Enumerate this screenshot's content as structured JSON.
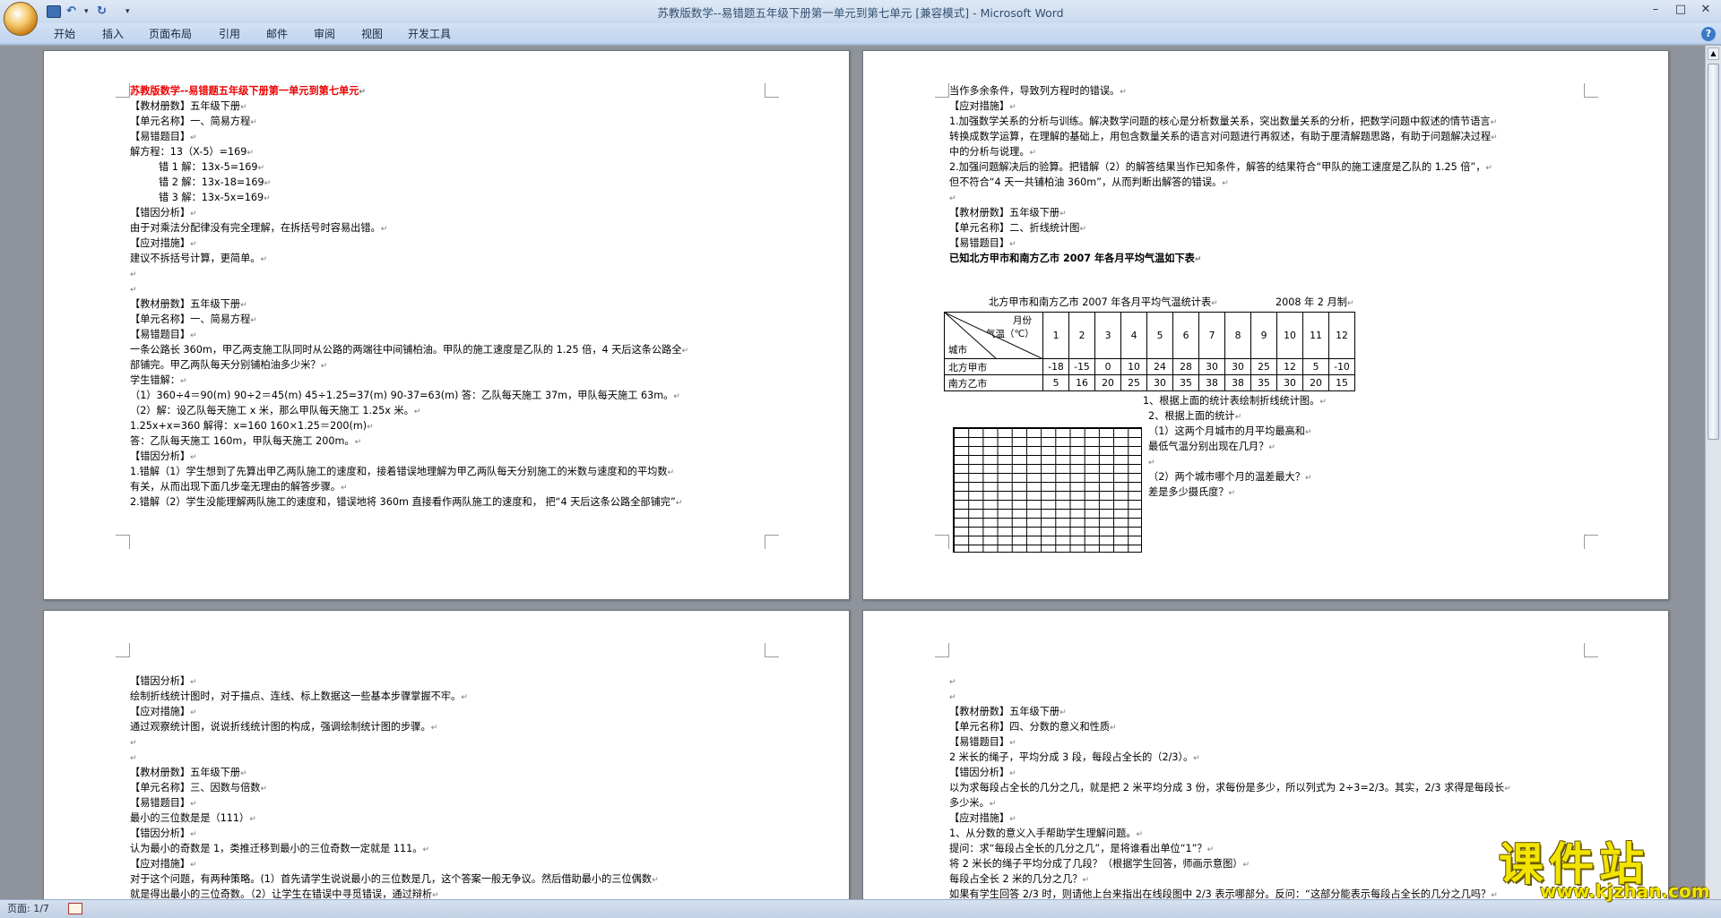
{
  "window": {
    "title": "苏教版数学--易错题五年级下册第一单元到第七单元 [兼容模式] - Microsoft Word"
  },
  "quick_access": {
    "save_icon": "save-icon",
    "undo_icon": "undo-icon",
    "redo_icon": "redo-icon"
  },
  "ribbon": {
    "tabs": [
      "开始",
      "插入",
      "页面布局",
      "引用",
      "邮件",
      "审阅",
      "视图",
      "开发工具"
    ]
  },
  "status": {
    "page": "页面: 1/7"
  },
  "watermark": {
    "text": "课件站",
    "url": "www.kjzhan.com"
  },
  "page1": {
    "lines": [
      "苏教版数学--易错题五年级下册第一单元到第七单元",
      "【教材册数】五年级下册",
      "【单元名称】一、简易方程",
      "【易错题目】",
      "解方程：13（X-5）=169",
      "错 1 解：13x-5=169",
      "错 2 解：13x-18=169",
      "错 3 解：13x-5x=169",
      "【错因分析】",
      "由于对乘法分配律没有完全理解，在拆括号时容易出错。",
      "【应对措施】",
      "建议不拆括号计算，更简单。",
      "",
      "",
      "【教材册数】五年级下册",
      "【单元名称】一、简易方程",
      "【易错题目】",
      "一条公路长 360m，甲乙两支施工队同时从公路的两端往中间铺柏油。甲队的施工速度是乙队的 1.25 倍，4 天后这条公路全",
      "部铺完。甲乙两队每天分别铺柏油多少米？",
      "学生错解：",
      "（1）360÷4＝90(m)    90÷2＝45(m)    45÷1.25=37(m)    90-37=63(m) 答：乙队每天施工 37m，甲队每天施工 63m。",
      "（2）解：设乙队每天施工 x 米，那么甲队每天施工 1.25x 米。",
      "1.25x+x=360 解得：x=160    160×1.25＝200(m)",
      "答：乙队每天施工 160m，甲队每天施工 200m。",
      "【错因分析】",
      "1.错解（1）学生想到了先算出甲乙两队施工的速度和，接着错误地理解为甲乙两队每天分别施工的米数与速度和的平均数",
      "有关，从而出现下面几步毫无理由的解答步骤。",
      "2.错解（2）学生没能理解两队施工的速度和，错误地将 360m 直接看作两队施工的速度和，  把“4 天后这条公路全部铺完”"
    ]
  },
  "page2": {
    "lines": [
      "当作多余条件，导致列方程时的错误。",
      "【应对措施】",
      "1.加强数学关系的分析与训练。解决数学问题的核心是分析数量关系，突出数量关系的分析，把数学问题中叙述的情节语言",
      "转换成数学运算，在理解的基础上，用包含数量关系的语言对问题进行再叙述，有助于厘清解题思路，有助于问题解决过程",
      "中的分析与说理。",
      "2.加强问题解决后的验算。把错解（2）的解答结果当作已知条件，解答的结果符合“甲队的施工速度是乙队的 1.25 倍”，",
      "但不符合“4 天一共铺柏油 360m”，从而判断出解答的错误。",
      "",
      "【教材册数】五年级下册",
      "【单元名称】二、折线统计图",
      "【易错题目】",
      "已知北方甲市和南方乙市 2007 年各月平均气温如下表"
    ],
    "table_caption": "北方甲市和南方乙市 2007 年各月平均气温统计表",
    "table_date": "2008 年 2 月制",
    "table_header_labels": {
      "month": "月份",
      "temp": "气温（℃）",
      "city": "城市"
    },
    "months": [
      "1",
      "2",
      "3",
      "4",
      "5",
      "6",
      "7",
      "8",
      "9",
      "10",
      "11",
      "12"
    ],
    "rows": [
      {
        "city": "北方甲市",
        "values": [
          "-18",
          "-15",
          "0",
          "10",
          "24",
          "28",
          "30",
          "30",
          "25",
          "12",
          "5",
          "-10"
        ]
      },
      {
        "city": "南方乙市",
        "values": [
          "5",
          "16",
          "20",
          "25",
          "30",
          "35",
          "38",
          "38",
          "35",
          "30",
          "20",
          "15"
        ]
      }
    ],
    "questions": [
      "1、根据上面的统计表绘制折线统计图。",
      "2、根据上面的统计",
      "（1）这两个月城市的月平均最高和",
      "最低气温分别出现在几月？",
      "",
      "（2）两个城市哪个月的温差最大？",
      "差是多少摄氏度？"
    ]
  },
  "page3": {
    "lines": [
      "【错因分析】",
      "绘制折线统计图时，对于描点、连线、标上数据这一些基本步骤掌握不牢。",
      "【应对措施】",
      "通过观察统计图，说说折线统计图的构成，强调绘制统计图的步骤。",
      "",
      "",
      "【教材册数】五年级下册",
      "【单元名称】三、因数与倍数",
      "【易错题目】",
      "最小的三位数是是（111）",
      "【错因分析】",
      "认为最小的奇数是 1，类推迁移到最小的三位奇数一定就是 111。",
      "【应对措施】",
      "对于这个问题，有两种策略。(1）首先请学生说说最小的三位数是几，这个答案一般无争议。然后借助最小的三位偶数",
      "就是得出最小的三位奇数。（2）让学生在错误中寻觅错误，通过辩析"
    ]
  },
  "page4": {
    "lines": [
      "",
      "",
      "【教材册数】五年级下册",
      "【单元名称】四、分数的意义和性质",
      "【易错题目】",
      "2 米长的绳子，平均分成 3 段，每段占全长的（2/3）。",
      "【错因分析】",
      "以为求每段占全长的几分之几，就是把 2 米平均分成 3 份，求每份是多少，所以列式为 2÷3=2/3。其实，2/3 求得是每段长",
      "多少米。",
      "【应对措施】",
      "1、从分数的意义入手帮助学生理解问题。",
      "提问：求“每段占全长的几分之几”，是将谁看出单位“1”？",
      "将 2 米长的绳子平均分成了几段？（根据学生回答，师画示意图）",
      "每段占全长 2 米的几分之几？",
      "如果有学生回答 2/3 时，则请他上台来指出在线段图中 2/3 表示哪部分。反问：“这部分能表示每段占全长的几分之几吗？"
    ]
  }
}
